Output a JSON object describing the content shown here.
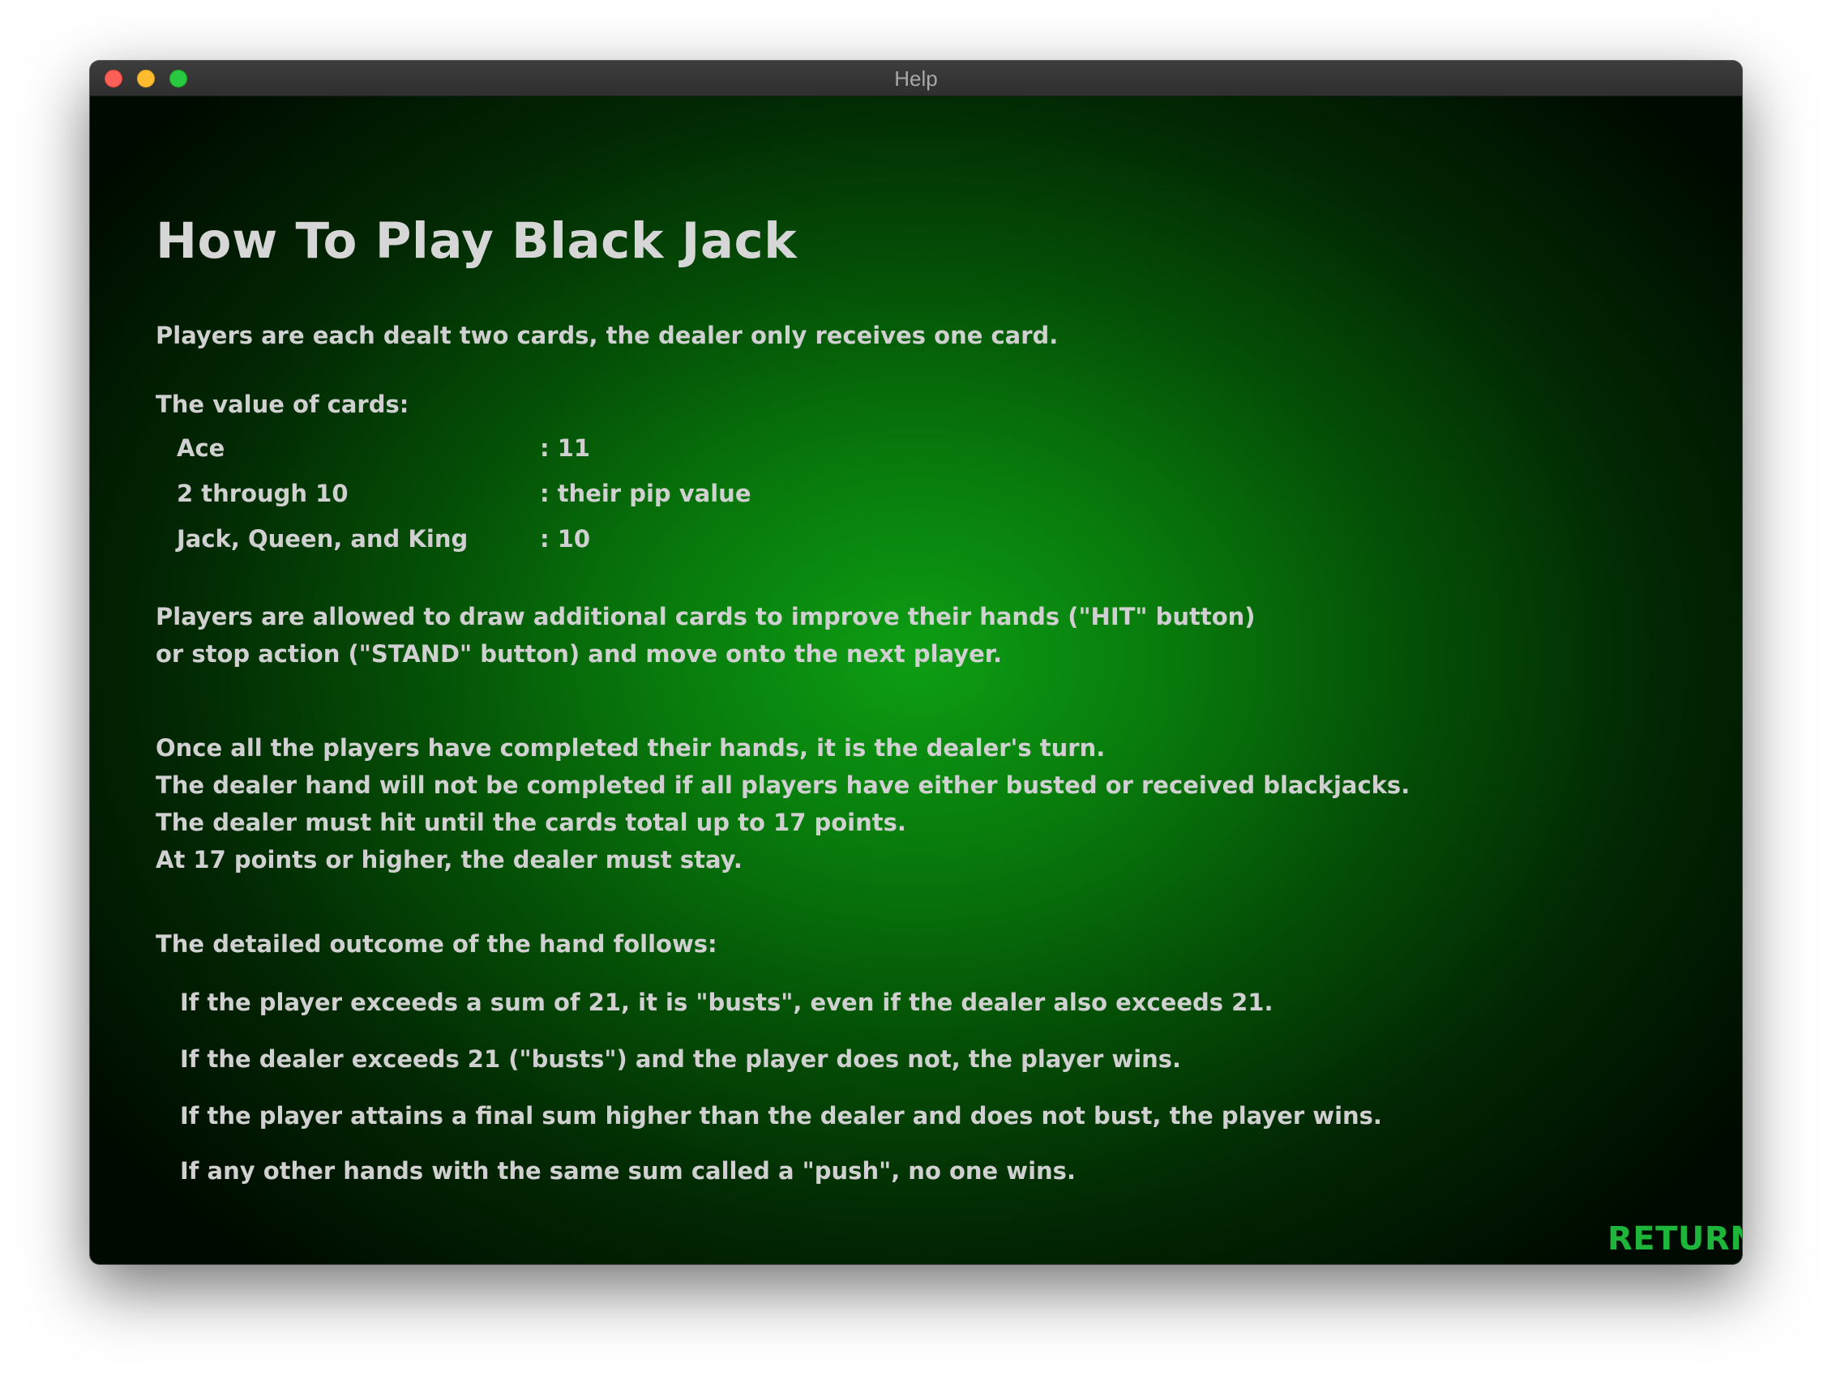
{
  "window": {
    "title": "Help"
  },
  "help": {
    "heading": "How To Play Black Jack",
    "intro": "Players are each dealt two cards, the dealer only receives one card.",
    "card_values_label": "The value of cards:",
    "card_values": [
      {
        "card": "Ace",
        "value": ": 11"
      },
      {
        "card": "2 through 10",
        "value": ": their pip value"
      },
      {
        "card": "Jack, Queen, and King",
        "value": ": 10"
      }
    ],
    "draw_rules": [
      "Players are allowed to draw additional cards to improve their hands (\"HIT\" button)",
      "or stop action (\"STAND\" button) and move onto the next player."
    ],
    "dealer_rules": [
      "Once all the players have completed their hands, it is the dealer's turn.",
      "The dealer hand will not be completed if all players have either busted or received blackjacks.",
      "The dealer must hit until the cards total up to 17 points.",
      "At 17 points or higher, the dealer must stay."
    ],
    "outcome_label": "The detailed outcome of the hand follows:",
    "outcomes": [
      "If the player exceeds a sum of 21, it is \"busts\", even if the dealer also exceeds 21.",
      "If the dealer exceeds 21 (\"busts\") and the player does not, the player wins.",
      "If the player attains a final sum higher than the dealer and does not bust, the player wins.",
      "If any other hands with the same sum called a \"push\", no one wins."
    ],
    "return_label": "RETURN"
  },
  "colors": {
    "background_center": "#0d9e14",
    "background_edge": "#000a00",
    "text": "#d0d0d0",
    "return_button": "#1db53a",
    "traffic_close": "#fe5f57",
    "traffic_minimize": "#febc2e",
    "traffic_maximize": "#28c840"
  }
}
